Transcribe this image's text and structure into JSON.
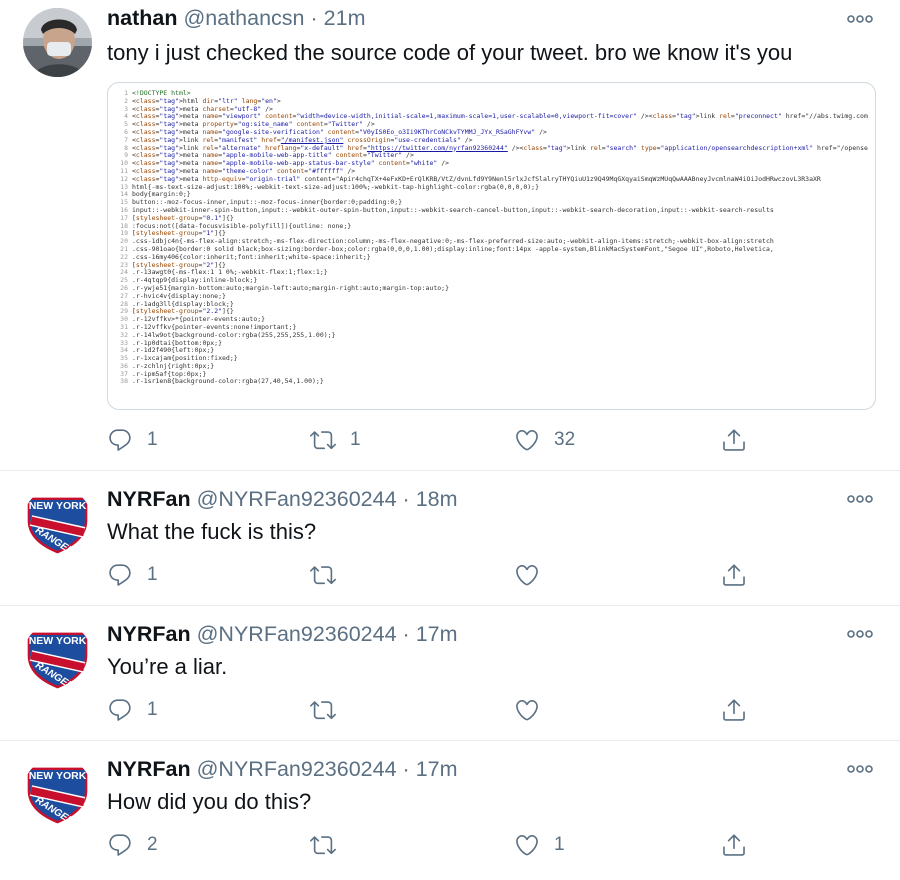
{
  "tweets": [
    {
      "author": "nathan",
      "handle": "@nathancsn",
      "sep": "·",
      "time": "21m",
      "text": "tony i just checked the source code of your tweet. bro we know it's you",
      "replies": "1",
      "retweets": "1",
      "likes": "32",
      "avatar": "photo-avatar"
    },
    {
      "author": "NYRFan",
      "handle": "@NYRFan92360244",
      "sep": "·",
      "time": "18m",
      "text": "What the fuck is this?",
      "replies": "1",
      "retweets": "",
      "likes": "",
      "avatar": "rangers-logo"
    },
    {
      "author": "NYRFan",
      "handle": "@NYRFan92360244",
      "sep": "·",
      "time": "17m",
      "text": "You’re a liar.",
      "replies": "1",
      "retweets": "",
      "likes": "",
      "avatar": "rangers-logo"
    },
    {
      "author": "NYRFan",
      "handle": "@NYRFan92360244",
      "sep": "·",
      "time": "17m",
      "text": "How did you do this?",
      "replies": "2",
      "retweets": "",
      "likes": "1",
      "avatar": "rangers-logo"
    }
  ],
  "logo": {
    "line1": "NEW YORK",
    "line2": "RANGERS"
  },
  "colors": {
    "text": "#0f1419",
    "muted": "#5b7083",
    "rangers_blue": "#1d4d9f",
    "rangers_red": "#c8102e"
  },
  "code_lines": [
    "<!DOCTYPE html>",
    "<html dir=\"ltr\" lang=\"en\">",
    "<meta charset=\"utf-8\" />",
    "<meta name=\"viewport\" content=\"width=device-width,initial-scale=1,maximum-scale=1,user-scalable=0,viewport-fit=cover\" /><link rel=\"preconnect\" href=\"//abs.twimg.com",
    "<meta property=\"og:site_name\" content=\"Twitter\" />",
    "<meta name=\"google-site-verification\" content=\"V0yIS0Eo_o3Ii9KThrCoNCkvTYMMJ_JYx_RSaGhFYvw\" />",
    "<link rel=\"manifest\" href=\"/manifest.json\" crossOrigin=\"use-credentials\" />",
    "<link rel=\"alternate\" hreflang=\"x-default\" href=\"https://twitter.com/nyrfan92360244\" /><link rel=\"search\" type=\"application/opensearchdescription+xml\" href=\"/opense",
    "<meta name=\"apple-mobile-web-app-title\" content=\"Twitter\" />",
    "<meta name=\"apple-mobile-web-app-status-bar-style\" content=\"white\" />",
    "<meta name=\"theme-color\" content=\"#ffffff\" />",
    "<meta http-equiv=\"origin-trial\" content=\"Apir4chqTX+4eFxKD+ErQlKRB/VtZ/dvnLfd9Y9Nenl5rlxJcfSlalryTHYQiuU1z9Q49MqGXqyaiSmqWzMUqQwAAABneyJvcmlnaW4iOiJodHRwczovL3R3aXR",
    "html{-ms-text-size-adjust:100%;-webkit-text-size-adjust:100%;-webkit-tap-highlight-color:rgba(0,0,0,0);}",
    "body{margin:0;}",
    "button::-moz-focus-inner,input::-moz-focus-inner{border:0;padding:0;}",
    "input::-webkit-inner-spin-button,input::-webkit-outer-spin-button,input::-webkit-search-cancel-button,input::-webkit-search-decoration,input::-webkit-search-results",
    "[stylesheet-group=\"0.1\"]{}",
    ":focus:not([data-focusvisible-polyfill]){outline: none;}",
    "[stylesheet-group=\"1\"]{}",
    ".css-1dbjc4n{-ms-flex-align:stretch;-ms-flex-direction:column;-ms-flex-negative:0;-ms-flex-preferred-size:auto;-webkit-align-items:stretch;-webkit-box-align:stretch",
    ".css-901oao{border:0 solid black;box-sizing:border-box;color:rgba(0,0,0,1.00);display:inline;font:14px -apple-system,BlinkMacSystemFont,\"Segoe UI\",Roboto,Helvetica,",
    ".css-16my406{color:inherit;font:inherit;white-space:inherit;}",
    "[stylesheet-group=\"2\"]{}",
    ".r-13awgt0{-ms-flex:1 1 0%;-webkit-flex:1;flex:1;}",
    ".r-4qtqp9{display:inline-block;}",
    ".r-ywje51{margin-bottom:auto;margin-left:auto;margin-right:auto;margin-top:auto;}",
    ".r-hvic4v{display:none;}",
    ".r-1adg3ll{display:block;}",
    "[stylesheet-group=\"2.2\"]{}",
    ".r-12vffkv>*{pointer-events:auto;}",
    ".r-12vffkv{pointer-events:none!important;}",
    ".r-14lw9ot{background-color:rgba(255,255,255,1.00);}",
    ".r-1p0dtai{bottom:0px;}",
    ".r-1d2f490{left:0px;}",
    ".r-1xcajam{position:fixed;}",
    ".r-zchlnj{right:0px;}",
    ".r-ipm5af{top:0px;}",
    ".r-1sr1en8{background-color:rgba(27,40,54,1.00);}"
  ]
}
